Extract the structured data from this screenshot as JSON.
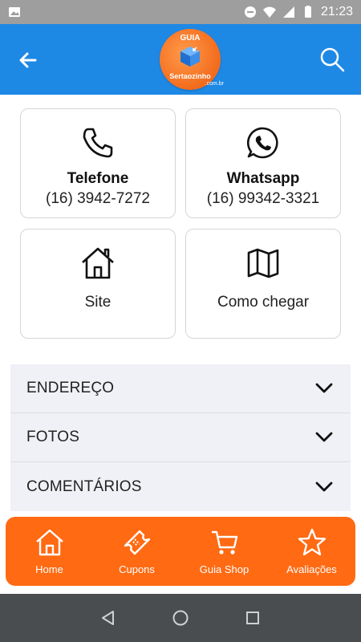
{
  "status_bar": {
    "time": "21:23",
    "icons": [
      "image-icon",
      "dnd-icon",
      "wifi-icon",
      "signal-icon",
      "battery-icon"
    ]
  },
  "app_bar": {
    "background": "#1e88e5",
    "logo": {
      "top_text": "GUIA",
      "bottom_text": "Sertaozinho",
      "suffix": ".com.br"
    }
  },
  "contact_cards": [
    {
      "icon": "phone-icon",
      "title": "Telefone",
      "value": "(16) 3942-7272"
    },
    {
      "icon": "whatsapp-icon",
      "title": "Whatsapp",
      "value": "(16) 99342-3321"
    },
    {
      "icon": "home-icon",
      "label": "Site"
    },
    {
      "icon": "map-icon",
      "label": "Como chegar"
    }
  ],
  "accordion": [
    {
      "label": "ENDEREÇO"
    },
    {
      "label": "FOTOS"
    },
    {
      "label": "COMENTÁRIOS"
    }
  ],
  "bottom_nav": {
    "background": "#ff6a13",
    "items": [
      {
        "icon": "home-icon",
        "label": "Home"
      },
      {
        "icon": "ticket-icon",
        "label": "Cupons"
      },
      {
        "icon": "cart-icon",
        "label": "Guia Shop"
      },
      {
        "icon": "star-icon",
        "label": "Avaliações"
      }
    ]
  }
}
